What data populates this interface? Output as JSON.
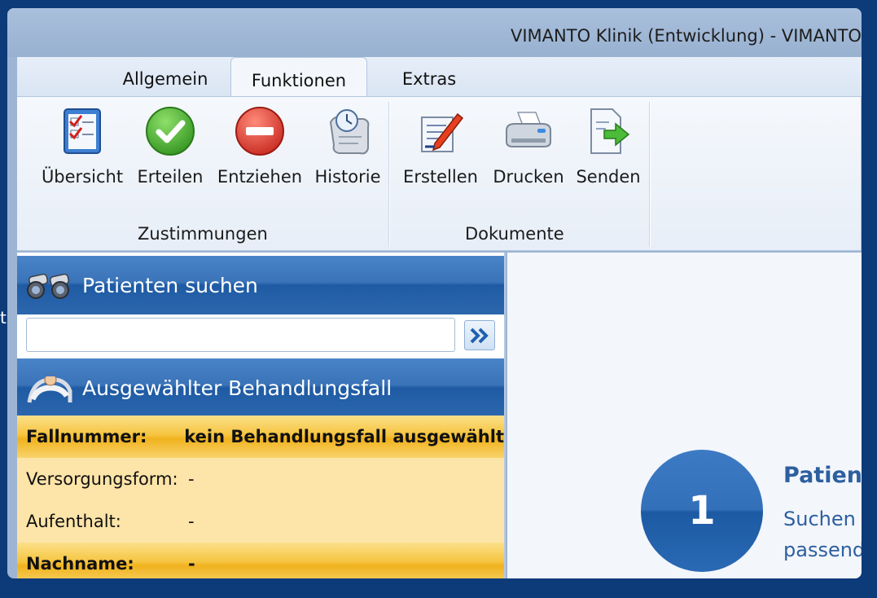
{
  "window": {
    "title": "VIMANTO Klinik (Entwicklung) - VIMANTO"
  },
  "stray_text": "t",
  "tabs": [
    {
      "label": "Allgemein",
      "active": false
    },
    {
      "label": "Funktionen",
      "active": true
    },
    {
      "label": "Extras",
      "active": false
    }
  ],
  "ribbon": {
    "groups": [
      {
        "label": "Zustimmungen",
        "buttons": [
          {
            "label": "Übersicht",
            "icon": "checklist-icon"
          },
          {
            "label": "Erteilen",
            "icon": "green-check-icon"
          },
          {
            "label": "Entziehen",
            "icon": "red-minus-icon"
          },
          {
            "label": "Historie",
            "icon": "history-scroll-clock-icon"
          }
        ]
      },
      {
        "label": "Dokumente",
        "buttons": [
          {
            "label": "Erstellen",
            "icon": "document-pen-icon"
          },
          {
            "label": "Drucken",
            "icon": "printer-icon"
          },
          {
            "label": "Senden",
            "icon": "document-send-icon"
          }
        ]
      }
    ]
  },
  "patient_search": {
    "header": "Patienten suchen",
    "input_value": "",
    "go_icon": "double-chevron-right-icon"
  },
  "selected_case": {
    "header": "Ausgewählter Behandlungsfall",
    "rows": [
      {
        "key": "Fallnummer:",
        "value": "kein Behandlungsfall ausgewählt",
        "highlight": true
      },
      {
        "key": "Versorgungsform:",
        "value": "-",
        "highlight": false
      },
      {
        "key": "Aufenthalt:",
        "value": "-",
        "highlight": false
      },
      {
        "key": "Nachname:",
        "value": "-",
        "highlight": true
      }
    ]
  },
  "step": {
    "number": "1",
    "title": "Patient",
    "text_line1": "Suchen",
    "text_line2": "passend"
  },
  "colors": {
    "background": "#0d3a78",
    "header_blue": "#2c67ad",
    "highlight_orange": "#f6c541",
    "row_beige": "#fde4a8",
    "step_text": "#2d5f9f"
  }
}
